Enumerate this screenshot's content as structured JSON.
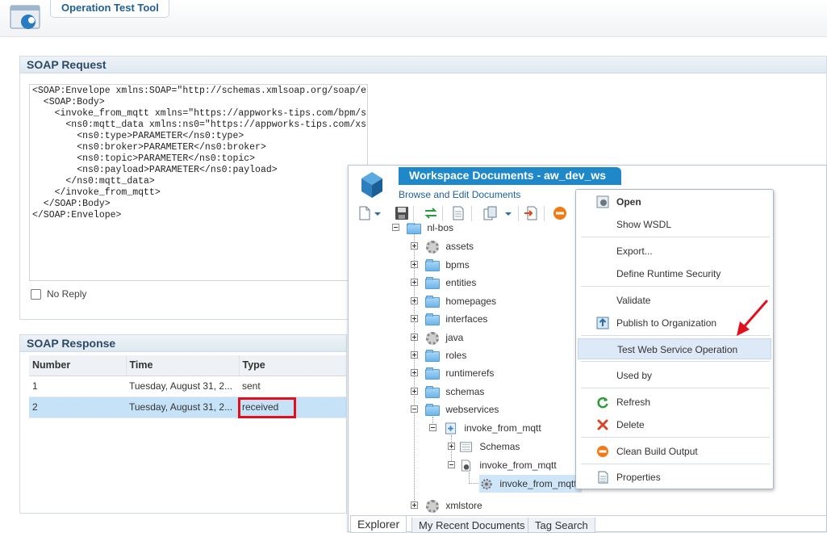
{
  "app": {
    "title": "Operation Test Tool",
    "icon": "operation-test-tool-icon"
  },
  "request": {
    "title": "SOAP Request",
    "xml": "<SOAP:Envelope xmlns:SOAP=\"http://schemas.xmlsoap.org/soap/envelope/\">\n  <SOAP:Body>\n    <invoke_from_mqtt xmlns=\"https://appworks-tips.com/bpm/sample\">\n      <ns0:mqtt_data xmlns:ns0=\"https://appworks-tips.com/xsd/sample\">\n        <ns0:type>PARAMETER</ns0:type>\n        <ns0:broker>PARAMETER</ns0:broker>\n        <ns0:topic>PARAMETER</ns0:topic>\n        <ns0:payload>PARAMETER</ns0:payload>\n      </ns0:mqtt_data>\n    </invoke_from_mqtt>\n  </SOAP:Body>\n</SOAP:Envelope>",
    "no_reply_label": "No Reply",
    "no_reply_checked": false
  },
  "response": {
    "title": "SOAP Response",
    "columns": {
      "number": "Number",
      "time": "Time",
      "type": "Type"
    },
    "rows": [
      {
        "number": "1",
        "time": "Tuesday, August 31, 2...",
        "type": "sent"
      },
      {
        "number": "2",
        "time": "Tuesday, August 31, 2...",
        "type": "received"
      }
    ],
    "highlight_color": "#e0101e"
  },
  "workspace": {
    "title": "Workspace Documents - aw_dev_ws",
    "subtitle": "Browse and Edit Documents",
    "accent": "#1e88c9",
    "toolbar_icons": [
      "new-document-icon",
      "dropdown-icon",
      "save-icon",
      "synchronize-icon",
      "document-icon",
      "copy-icon",
      "dropdown-icon",
      "export-icon",
      "stop-icon"
    ],
    "tree": {
      "root": "nl-bos",
      "items": [
        {
          "label": "assets",
          "icon": "gear-icon"
        },
        {
          "label": "bpms",
          "icon": "folder-icon"
        },
        {
          "label": "entities",
          "icon": "folder-icon"
        },
        {
          "label": "homepages",
          "icon": "folder-icon"
        },
        {
          "label": "interfaces",
          "icon": "folder-icon"
        },
        {
          "label": "java",
          "icon": "gear-icon"
        },
        {
          "label": "roles",
          "icon": "folder-icon"
        },
        {
          "label": "runtimerefs",
          "icon": "folder-icon"
        },
        {
          "label": "schemas",
          "icon": "folder-icon"
        },
        {
          "label": "webservices",
          "icon": "folder-open-icon"
        }
      ],
      "webservice_package": "invoke_from_mqtt",
      "schemas_node": "Schemas",
      "interface_node": "invoke_from_mqtt",
      "operation_node": "invoke_from_mqtt",
      "last_item": "xmlstore"
    },
    "tabs": {
      "explorer": "Explorer",
      "recent": "My Recent Documents",
      "tags": "Tag Search"
    }
  },
  "context_menu": {
    "open": "Open",
    "show_wsdl": "Show WSDL",
    "export": "Export...",
    "define_security": "Define Runtime Security",
    "validate": "Validate",
    "publish": "Publish to Organization",
    "test_ws": "Test Web Service Operation",
    "used_by": "Used by",
    "refresh": "Refresh",
    "delete": "Delete",
    "clean": "Clean Build Output",
    "properties": "Properties"
  }
}
